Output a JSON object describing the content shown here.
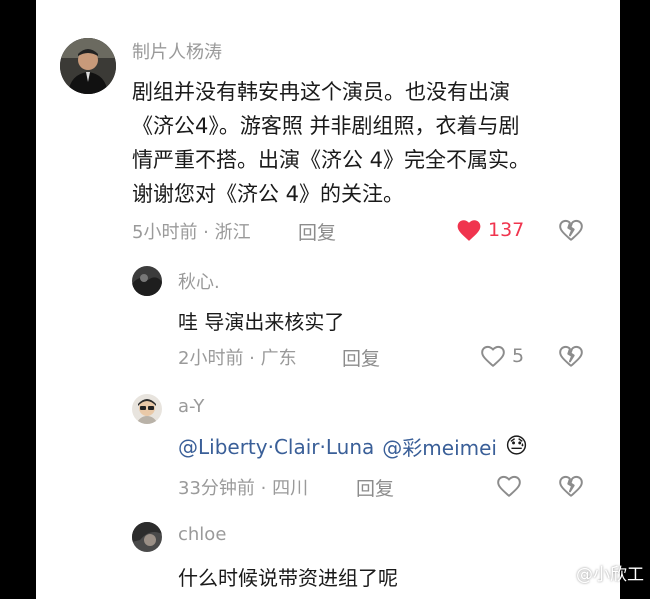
{
  "comments": [
    {
      "author": "制片人杨涛",
      "lines": [
        "剧组并没有韩安冉这个演员。也没有出演",
        "《济公4》。游客照 并非剧组照，衣着与剧",
        "情严重不搭。出演《济公 4》完全不属实。",
        "谢谢您对《济公 4》的关注。"
      ],
      "meta": "5小时前 · 浙江",
      "reply_label": "回复",
      "likes": "137",
      "liked": true
    },
    {
      "author": "秋心.",
      "text": "哇 导演出来核实了",
      "meta": "2小时前 · 广东",
      "reply_label": "回复",
      "likes": "5"
    },
    {
      "author": "a-Y",
      "mention1": "@Liberty·Clair·Luna",
      "mention2": "@彩meimei",
      "emoji": "😓",
      "meta": "33分钟前 · 四川",
      "reply_label": "回复"
    },
    {
      "author": "chloe",
      "text": "什么时候说带资进组了呢"
    }
  ],
  "watermark": "@小欣工",
  "colors": {
    "like_red": "#f0344e",
    "mention_blue": "#3a5f98"
  }
}
